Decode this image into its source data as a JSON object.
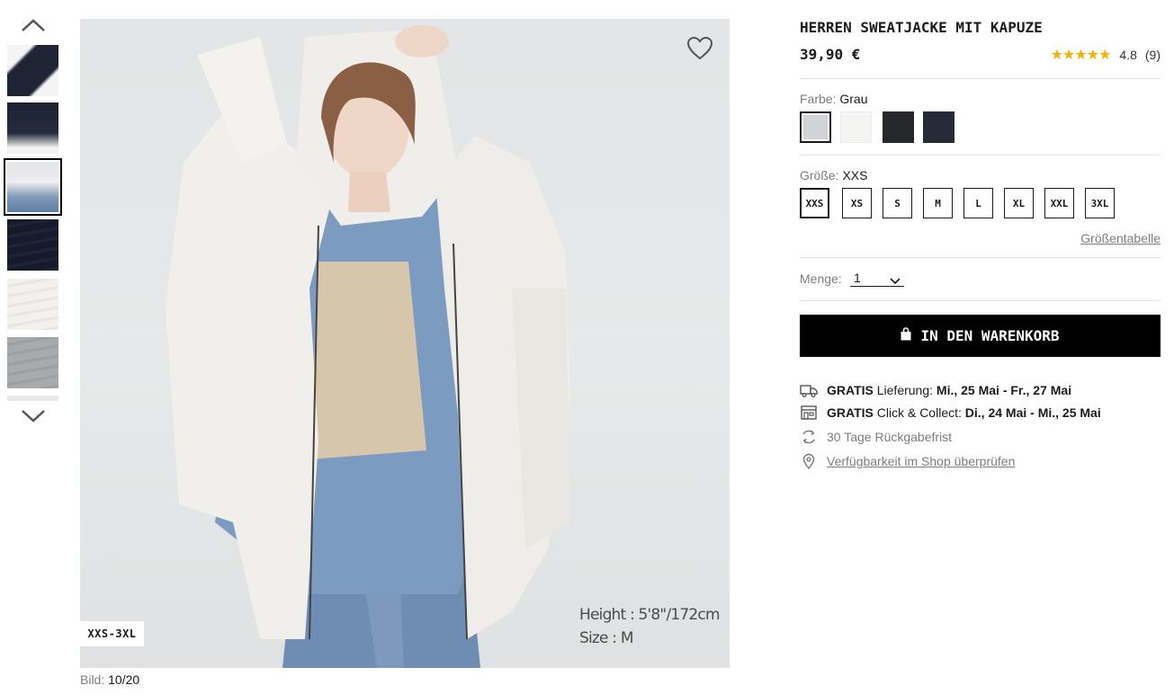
{
  "gallery": {
    "counter_label": "Bild:",
    "counter_value": "10/20",
    "size_range_tag": "XXS-3XL",
    "model_height": "Height : 5'8\"/172cm",
    "model_size": "Size : M"
  },
  "product": {
    "title": "HERREN SWEATJACKE MIT KAPUZE",
    "price": "39,90 €",
    "stars": "★★★★★",
    "rating": "4.8",
    "review_count": "(9)"
  },
  "color": {
    "label": "Farbe:",
    "selected": "Grau",
    "swatches": [
      "#d2d3d6",
      "#f4f4f2",
      "#26282c",
      "#262a36"
    ]
  },
  "size": {
    "label": "Größe:",
    "selected": "XXS",
    "options": [
      "XXS",
      "XS",
      "S",
      "M",
      "L",
      "XL",
      "XXL",
      "3XL"
    ],
    "chart_link": "Größentabelle"
  },
  "quantity": {
    "label": "Menge:",
    "value": "1"
  },
  "cart_button": "IN DEN WARENKORB",
  "delivery": {
    "free": "GRATIS",
    "label": "Lieferung:",
    "dates": "Mi., 25 Mai - Fr., 27 Mai"
  },
  "click_collect": {
    "free": "GRATIS",
    "label": "Click & Collect:",
    "dates": "Di., 24 Mai - Mi., 25 Mai"
  },
  "returns": "30 Tage Rückgabefrist",
  "store_check": "Verfügbarkeit im Shop überprüfen",
  "colors": {
    "accent": "#000000",
    "star": "#f3b300",
    "muted_text": "#7d7d7d"
  }
}
